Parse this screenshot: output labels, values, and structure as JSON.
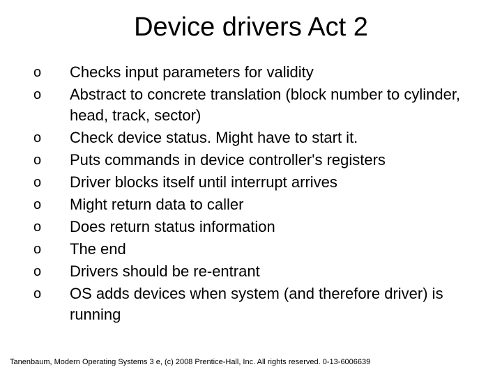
{
  "title": "Device drivers Act 2",
  "bullets": {
    "b0": "Checks input parameters for validity",
    "b1": "Abstract to concrete translation (block number to cylinder, head, track, sector)",
    "b2": "Check device status. Might have to start it.",
    "b3": "Puts commands in device controller's registers",
    "b4": "Driver blocks itself until interrupt arrives",
    "b5": "Might return data to caller",
    "b6": "Does return status information",
    "b7": "The end",
    "b8": "Drivers should be re-entrant",
    "b9": "OS adds devices when system (and therefore driver) is running"
  },
  "bullet_marker": "o",
  "footer": "Tanenbaum, Modern Operating Systems 3 e, (c) 2008 Prentice-Hall, Inc. All rights reserved. 0-13-6006639"
}
